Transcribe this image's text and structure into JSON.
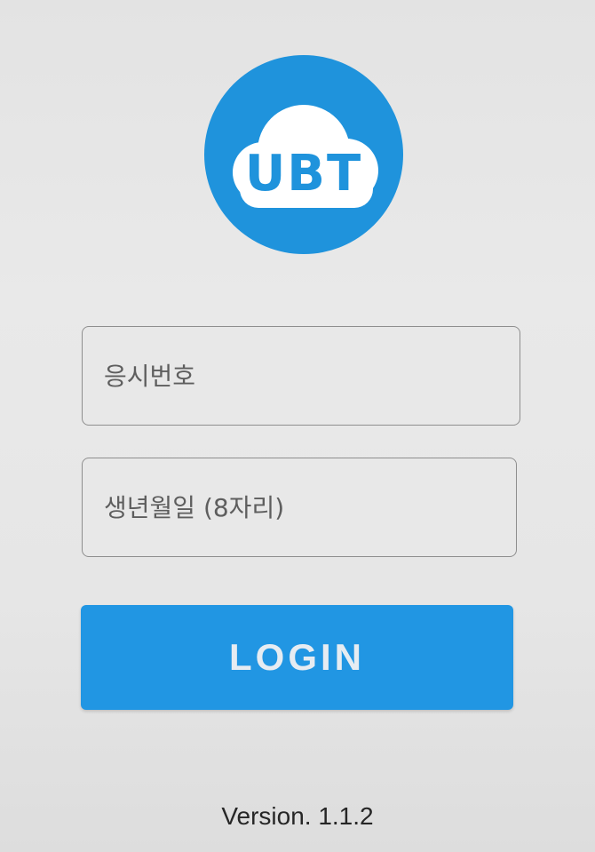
{
  "app": {
    "logo_text": "UBT",
    "brand_color": "#1f93dc"
  },
  "form": {
    "exam_number_placeholder": "응시번호",
    "exam_number_value": "",
    "birthdate_placeholder": "생년월일 (8자리)",
    "birthdate_value": "",
    "login_label": "LOGIN"
  },
  "footer": {
    "version": "Version. 1.1.2"
  },
  "icons": {
    "logo": "cloud-icon"
  }
}
